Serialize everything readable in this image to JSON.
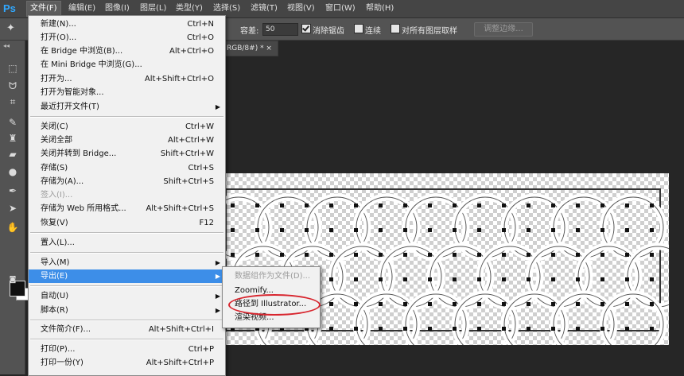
{
  "app": {
    "logo": "Ps"
  },
  "menubar": {
    "items": [
      {
        "label": "文件(F)",
        "active": true
      },
      {
        "label": "编辑(E)"
      },
      {
        "label": "图像(I)"
      },
      {
        "label": "图层(L)"
      },
      {
        "label": "类型(Y)"
      },
      {
        "label": "选择(S)"
      },
      {
        "label": "滤镜(T)"
      },
      {
        "label": "视图(V)"
      },
      {
        "label": "窗口(W)"
      },
      {
        "label": "帮助(H)"
      }
    ]
  },
  "options": {
    "tolerance_label": "容差:",
    "tolerance_value": "50",
    "antialias_label": "消除锯齿",
    "antialias_checked": true,
    "contiguous_label": "连续",
    "contiguous_checked": false,
    "sample_all_label": "对所有图层取样",
    "sample_all_checked": false,
    "refine_edge_label": "调整边缘..."
  },
  "document": {
    "tab_label": "RGB/8#) *  ×"
  },
  "toolbar": {
    "tools": [
      "move-icon",
      "marquee-icon",
      "lasso-icon",
      "crop-icon",
      "brush-icon",
      "stamp-icon",
      "eraser-icon",
      "blur-icon",
      "pen-icon",
      "path-select-icon",
      "hand-icon"
    ]
  },
  "file_menu": {
    "items": [
      {
        "label": "新建(N)...",
        "shortcut": "Ctrl+N"
      },
      {
        "label": "打开(O)...",
        "shortcut": "Ctrl+O"
      },
      {
        "label": "在 Bridge 中浏览(B)...",
        "shortcut": "Alt+Ctrl+O"
      },
      {
        "label": "在 Mini Bridge 中浏览(G)...",
        "shortcut": ""
      },
      {
        "label": "打开为...",
        "shortcut": "Alt+Shift+Ctrl+O"
      },
      {
        "label": "打开为智能对象...",
        "shortcut": ""
      },
      {
        "label": "最近打开文件(T)",
        "shortcut": "",
        "submenu": true
      },
      {
        "label": "关闭(C)",
        "shortcut": "Ctrl+W"
      },
      {
        "label": "关闭全部",
        "shortcut": "Alt+Ctrl+W"
      },
      {
        "label": "关闭并转到 Bridge...",
        "shortcut": "Shift+Ctrl+W"
      },
      {
        "label": "存储(S)",
        "shortcut": "Ctrl+S"
      },
      {
        "label": "存储为(A)...",
        "shortcut": "Shift+Ctrl+S"
      },
      {
        "label": "签入(I)...",
        "shortcut": "",
        "disabled": true
      },
      {
        "label": "存储为 Web 所用格式...",
        "shortcut": "Alt+Shift+Ctrl+S"
      },
      {
        "label": "恢复(V)",
        "shortcut": "F12"
      },
      {
        "label": "置入(L)...",
        "shortcut": ""
      },
      {
        "label": "导入(M)",
        "shortcut": "",
        "submenu": true
      },
      {
        "label": "导出(E)",
        "shortcut": "",
        "submenu": true,
        "highlighted": true
      },
      {
        "label": "自动(U)",
        "shortcut": "",
        "submenu": true
      },
      {
        "label": "脚本(R)",
        "shortcut": "",
        "submenu": true
      },
      {
        "label": "文件简介(F)...",
        "shortcut": "Alt+Shift+Ctrl+I"
      },
      {
        "label": "打印(P)...",
        "shortcut": "Ctrl+P"
      },
      {
        "label": "打印一份(Y)",
        "shortcut": "Alt+Shift+Ctrl+P"
      }
    ]
  },
  "export_menu": {
    "items": [
      {
        "label": "数据组作为文件(D)...",
        "disabled": true
      },
      {
        "label": "Zoomify..."
      },
      {
        "label": "路径到 Illustrator...",
        "circled": true
      },
      {
        "label": "渲染视频..."
      }
    ]
  },
  "colors": {
    "menu_highlight": "#3d8ee8",
    "annotation_red": "#d8262f",
    "ps_blue": "#31a8ff"
  }
}
